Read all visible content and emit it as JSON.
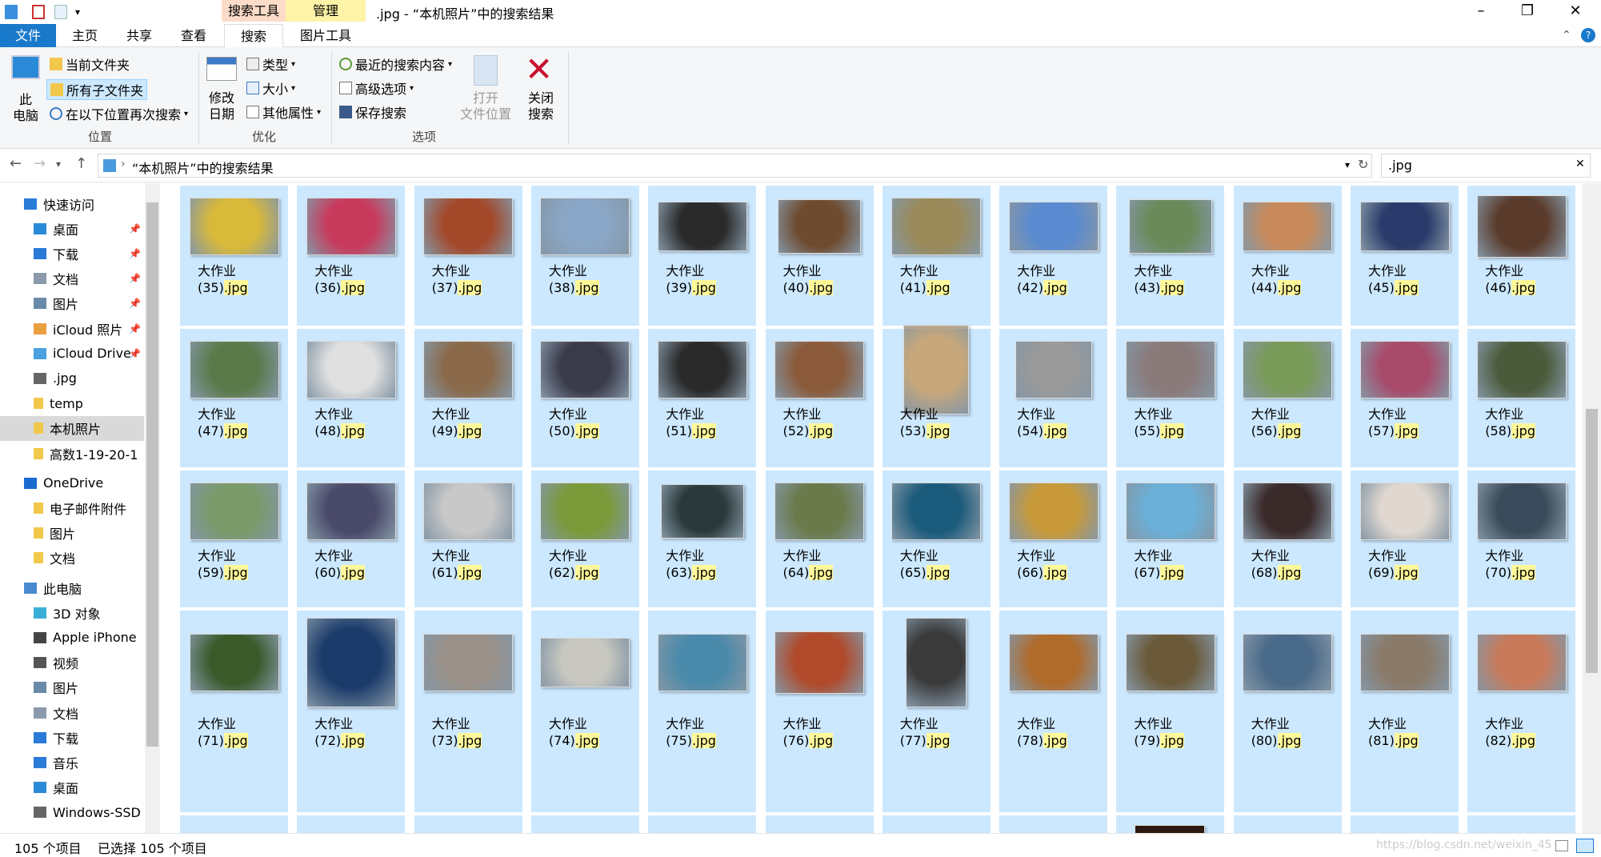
{
  "window": {
    "title": ".jpg - “本机照片”中的搜索结果",
    "contextual_tabs": [
      "搜索工具",
      "管理"
    ],
    "colors": {
      "accent": "#1979ca",
      "selection": "#cce8ff",
      "highlight": "#fff89a",
      "search_tools": "#fcdcc8",
      "manage": "#fef4a8"
    }
  },
  "ribbon_tabs": [
    "文件",
    "主页",
    "共享",
    "查看",
    "搜索",
    "图片工具"
  ],
  "ribbon": {
    "location": {
      "label": "位置",
      "this_pc": "此\n电脑",
      "current_folder": "当前文件夹",
      "all_subfolders": "所有子文件夹",
      "search_again": "在以下位置再次搜索"
    },
    "refine": {
      "label": "优化",
      "modified_date": "修改\n日期",
      "type": "类型",
      "size": "大小",
      "other_props": "其他属性"
    },
    "options": {
      "label": "选项",
      "recent_searches": "最近的搜索内容",
      "advanced": "高级选项",
      "save_search": "保存搜索",
      "open_location": "打开\n文件位置",
      "close_search": "关闭\n搜索"
    }
  },
  "address": {
    "path": "“本机照片”中的搜索结果",
    "search_query": ".jpg"
  },
  "nav": {
    "items": [
      {
        "label": "快速访问",
        "icon": "star-icon",
        "level": 0,
        "pinned": false
      },
      {
        "label": "桌面",
        "icon": "desktop-icon",
        "level": 1,
        "pinned": true
      },
      {
        "label": "下载",
        "icon": "download-icon",
        "level": 1,
        "pinned": true
      },
      {
        "label": "文档",
        "icon": "document-icon",
        "level": 1,
        "pinned": true
      },
      {
        "label": "图片",
        "icon": "picture-icon",
        "level": 1,
        "pinned": true
      },
      {
        "label": "iCloud 照片",
        "icon": "icloud-photos-icon",
        "level": 1,
        "pinned": true
      },
      {
        "label": "iCloud Drive",
        "icon": "icloud-icon",
        "level": 1,
        "pinned": true
      },
      {
        "label": ".jpg",
        "icon": "search-icon",
        "level": 1,
        "pinned": false
      },
      {
        "label": "temp",
        "icon": "folder-icon",
        "level": 1,
        "pinned": false
      },
      {
        "label": "本机照片",
        "icon": "folder-icon",
        "level": 1,
        "pinned": false
      },
      {
        "label": "高数1-19-20-1",
        "icon": "folder-icon",
        "level": 1,
        "pinned": false
      },
      {
        "label": "OneDrive",
        "icon": "onedrive-icon",
        "level": 0,
        "pinned": false
      },
      {
        "label": "电子邮件附件",
        "icon": "folder-icon",
        "level": 1,
        "pinned": false
      },
      {
        "label": "图片",
        "icon": "folder-icon",
        "level": 1,
        "pinned": false
      },
      {
        "label": "文档",
        "icon": "folder-icon",
        "level": 1,
        "pinned": false
      },
      {
        "label": "此电脑",
        "icon": "computer-icon",
        "level": 0,
        "pinned": false
      },
      {
        "label": "3D 对象",
        "icon": "cube-icon",
        "level": 1,
        "pinned": false
      },
      {
        "label": "Apple iPhone",
        "icon": "phone-icon",
        "level": 1,
        "pinned": false
      },
      {
        "label": "视频",
        "icon": "video-icon",
        "level": 1,
        "pinned": false
      },
      {
        "label": "图片",
        "icon": "picture-icon",
        "level": 1,
        "pinned": false
      },
      {
        "label": "文档",
        "icon": "document-icon",
        "level": 1,
        "pinned": false
      },
      {
        "label": "下载",
        "icon": "download-icon",
        "level": 1,
        "pinned": false
      },
      {
        "label": "音乐",
        "icon": "music-icon",
        "level": 1,
        "pinned": false
      },
      {
        "label": "桌面",
        "icon": "desktop-icon",
        "level": 1,
        "pinned": false
      },
      {
        "label": "Windows-SSD",
        "icon": "drive-icon",
        "level": 1,
        "pinned": false
      }
    ]
  },
  "files": {
    "name_prefix": "大作业",
    "ext": ".jpg",
    "rows": [
      [
        "(35)",
        "(36)",
        "(37)",
        "(38)",
        "(39)",
        "(40)",
        "(41)",
        "(42)",
        "(43)",
        "(44)",
        "(45)",
        "(46)"
      ],
      [
        "(47)",
        "(48)",
        "(49)",
        "(50)",
        "(51)",
        "(52)",
        "(53)",
        "(54)",
        "(55)",
        "(56)",
        "(57)",
        "(58)"
      ],
      [
        "(59)",
        "(60)",
        "(61)",
        "(62)",
        "(63)",
        "(64)",
        "(65)",
        "(66)",
        "(67)",
        "(68)",
        "(69)",
        "(70)"
      ],
      [
        "(71)",
        "(72)",
        "(73)",
        "(74)",
        "(75)",
        "(76)",
        "(77)",
        "(78)",
        "(79)",
        "(80)",
        "(81)",
        "(82)"
      ]
    ],
    "thumb_colors": [
      [
        "#d9b93a",
        "#c83a5c",
        "#a4482a",
        "#8aa6c6",
        "#2a2a2a",
        "#6e4a2e",
        "#9a8a5a",
        "#5a8ad0",
        "#6a8a5a",
        "#c88a5a",
        "#2a3a6a",
        "#5a3a2a"
      ],
      [
        "#5a7a4a",
        "#e0e0e0",
        "#8a6a4a",
        "#3a3a4a",
        "#2a2a2a",
        "#8a5a3a",
        "#c8a87a",
        "#9a9a9a",
        "#8a7a7a",
        "#7a9a5a",
        "#a84a6a",
        "#4a5a3a"
      ],
      [
        "#7a9a6a",
        "#4a4a6a",
        "#c8c8c8",
        "#7a9a3a",
        "#2a3a3a",
        "#6a7a4a",
        "#1a5a7a",
        "#c89a3a",
        "#6ab0d8",
        "#3a2a2a",
        "#e0d8d0",
        "#3a4a5a"
      ],
      [
        "#3a5a2a",
        "#1a3a6a",
        "#9a9088",
        "#c8c8c0",
        "#4a8aaa",
        "#b04a2a",
        "#3a3a3a",
        "#b06a2a",
        "#6a5a3a",
        "#4a6a8a",
        "#8a7a6a",
        "#c87a5a"
      ]
    ]
  },
  "status": {
    "item_count": "105 个项目",
    "selected": "已选择 105 个项目",
    "watermark": "https://blog.csdn.net/weixin_45"
  }
}
